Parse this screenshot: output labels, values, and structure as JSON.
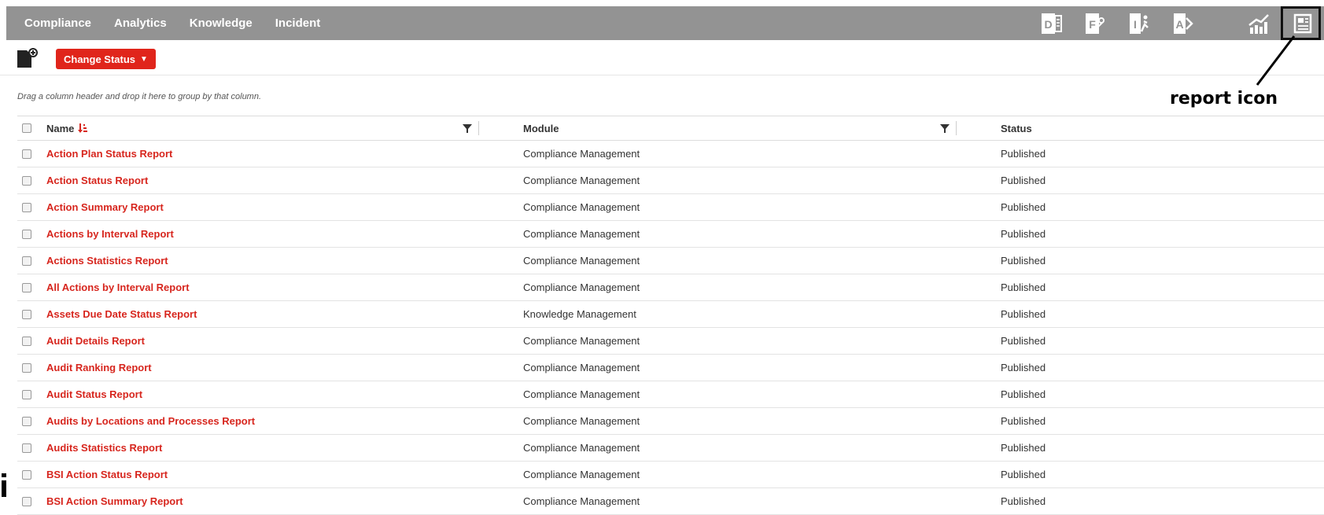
{
  "nav": {
    "items": [
      "Compliance",
      "Analytics",
      "Knowledge",
      "Incident"
    ]
  },
  "toolbar_icons": [
    {
      "name": "document-letter-d-icon",
      "letter": "D"
    },
    {
      "name": "form-letter-f-icon",
      "letter": "F"
    },
    {
      "name": "incident-letter-i-icon",
      "letter": "I"
    },
    {
      "name": "audit-letter-a-icon",
      "letter": "A"
    },
    {
      "name": "analytics-chart-icon"
    },
    {
      "name": "report-icon"
    }
  ],
  "actions": {
    "change_status_label": "Change Status",
    "caret": "▼"
  },
  "grid": {
    "group_hint": "Drag a column header and drop it here to group by that column.",
    "columns": [
      "Name",
      "Module",
      "Status"
    ],
    "rows": [
      {
        "name": "Action Plan Status Report",
        "module": "Compliance Management",
        "status": "Published"
      },
      {
        "name": "Action Status Report",
        "module": "Compliance Management",
        "status": "Published"
      },
      {
        "name": "Action Summary Report",
        "module": "Compliance Management",
        "status": "Published"
      },
      {
        "name": "Actions by Interval Report",
        "module": "Compliance Management",
        "status": "Published"
      },
      {
        "name": "Actions Statistics Report",
        "module": "Compliance Management",
        "status": "Published"
      },
      {
        "name": "All Actions by Interval Report",
        "module": "Compliance Management",
        "status": "Published"
      },
      {
        "name": "Assets Due Date Status Report",
        "module": "Knowledge Management",
        "status": "Published"
      },
      {
        "name": "Audit Details Report",
        "module": "Compliance Management",
        "status": "Published"
      },
      {
        "name": "Audit Ranking Report",
        "module": "Compliance Management",
        "status": "Published"
      },
      {
        "name": "Audit Status Report",
        "module": "Compliance Management",
        "status": "Published"
      },
      {
        "name": "Audits by Locations and Processes Report",
        "module": "Compliance Management",
        "status": "Published"
      },
      {
        "name": "Audits Statistics Report",
        "module": "Compliance Management",
        "status": "Published"
      },
      {
        "name": "BSI Action Status Report",
        "module": "Compliance Management",
        "status": "Published"
      },
      {
        "name": "BSI Action Summary Report",
        "module": "Compliance Management",
        "status": "Published"
      }
    ]
  },
  "annotation": {
    "label": "report icon"
  },
  "colors": {
    "topbar": "#939393",
    "accent": "#e0251b",
    "link": "#d7261e"
  }
}
